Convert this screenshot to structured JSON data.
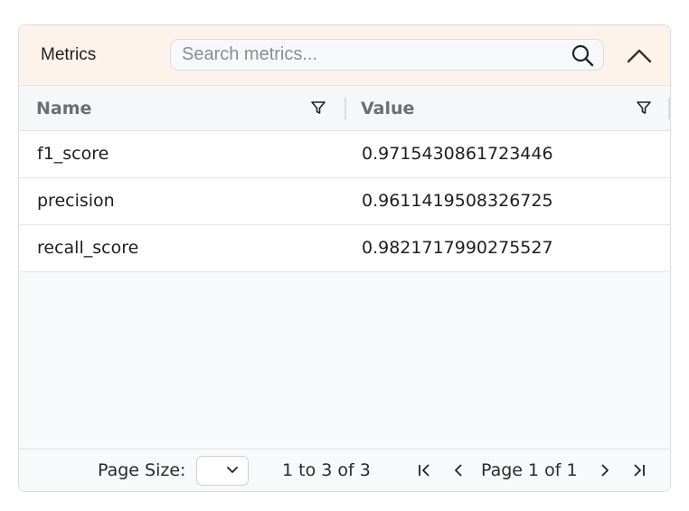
{
  "panel": {
    "title": "Metrics",
    "search": {
      "placeholder": "Search metrics...",
      "value": "",
      "icon": "search-icon"
    },
    "collapse_icon": "chevron-up-icon"
  },
  "grid": {
    "columns": [
      {
        "label": "Name",
        "filter_icon": "filter-icon"
      },
      {
        "label": "Value",
        "filter_icon": "filter-icon"
      }
    ],
    "rows": [
      {
        "name": "f1_score",
        "value": "0.9715430861723446"
      },
      {
        "name": "precision",
        "value": "0.9611419508326725"
      },
      {
        "name": "recall_score",
        "value": "0.9821717990275527"
      }
    ]
  },
  "pagination": {
    "page_size_label": "Page Size:",
    "page_size_value": "",
    "range_text": "1 to 3 of 3",
    "page_text": "Page 1 of 1",
    "icons": [
      "first-page-icon",
      "previous-page-icon",
      "next-page-icon",
      "last-page-icon"
    ]
  },
  "colors": {
    "header_bg": "#fdf3ea",
    "grid_bg": "#f8f9fa",
    "header_text": "#6e6e6e"
  }
}
